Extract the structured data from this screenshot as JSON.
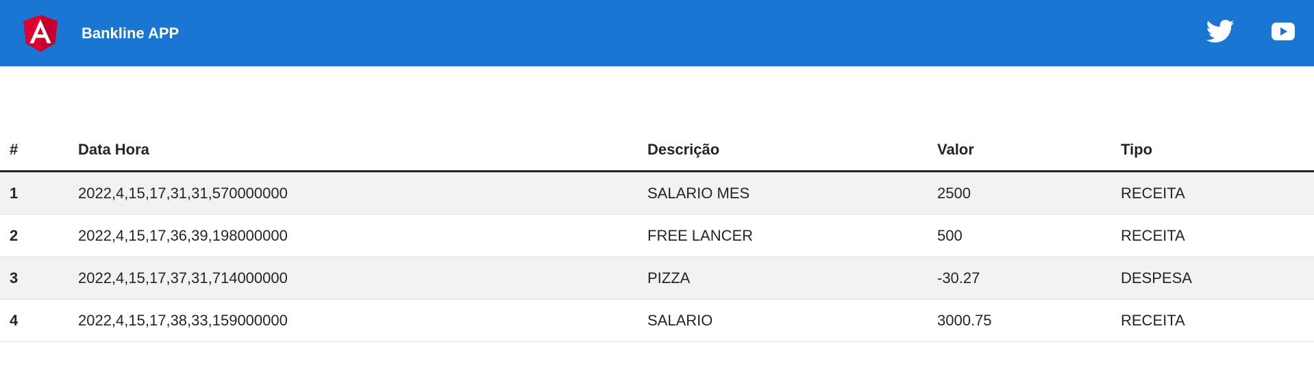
{
  "toolbar": {
    "title": "Bankline APP",
    "logo_icon": "angular-logo-icon",
    "twitter_icon": "twitter-icon",
    "youtube_icon": "youtube-icon",
    "colors": {
      "background": "#1976d2",
      "text": "#ffffff",
      "logo_red": "#dd0031",
      "logo_dark_red": "#c3002f"
    }
  },
  "table": {
    "headers": [
      "#",
      "Data Hora",
      "Descrição",
      "Valor",
      "Tipo"
    ],
    "rows": [
      {
        "idx": "1",
        "data_hora": "2022,4,15,17,31,31,570000000",
        "descricao": "SALARIO MES",
        "valor": "2500",
        "tipo": "RECEITA"
      },
      {
        "idx": "2",
        "data_hora": "2022,4,15,17,36,39,198000000",
        "descricao": "FREE LANCER",
        "valor": "500",
        "tipo": "RECEITA"
      },
      {
        "idx": "3",
        "data_hora": "2022,4,15,17,37,31,714000000",
        "descricao": "PIZZA",
        "valor": "-30.27",
        "tipo": "DESPESA"
      },
      {
        "idx": "4",
        "data_hora": "2022,4,15,17,38,33,159000000",
        "descricao": "SALARIO",
        "valor": "3000.75",
        "tipo": "RECEITA"
      }
    ],
    "colors": {
      "stripe": "#f2f2f2",
      "header_border": "#212529",
      "row_border": "#dee2e6"
    }
  }
}
